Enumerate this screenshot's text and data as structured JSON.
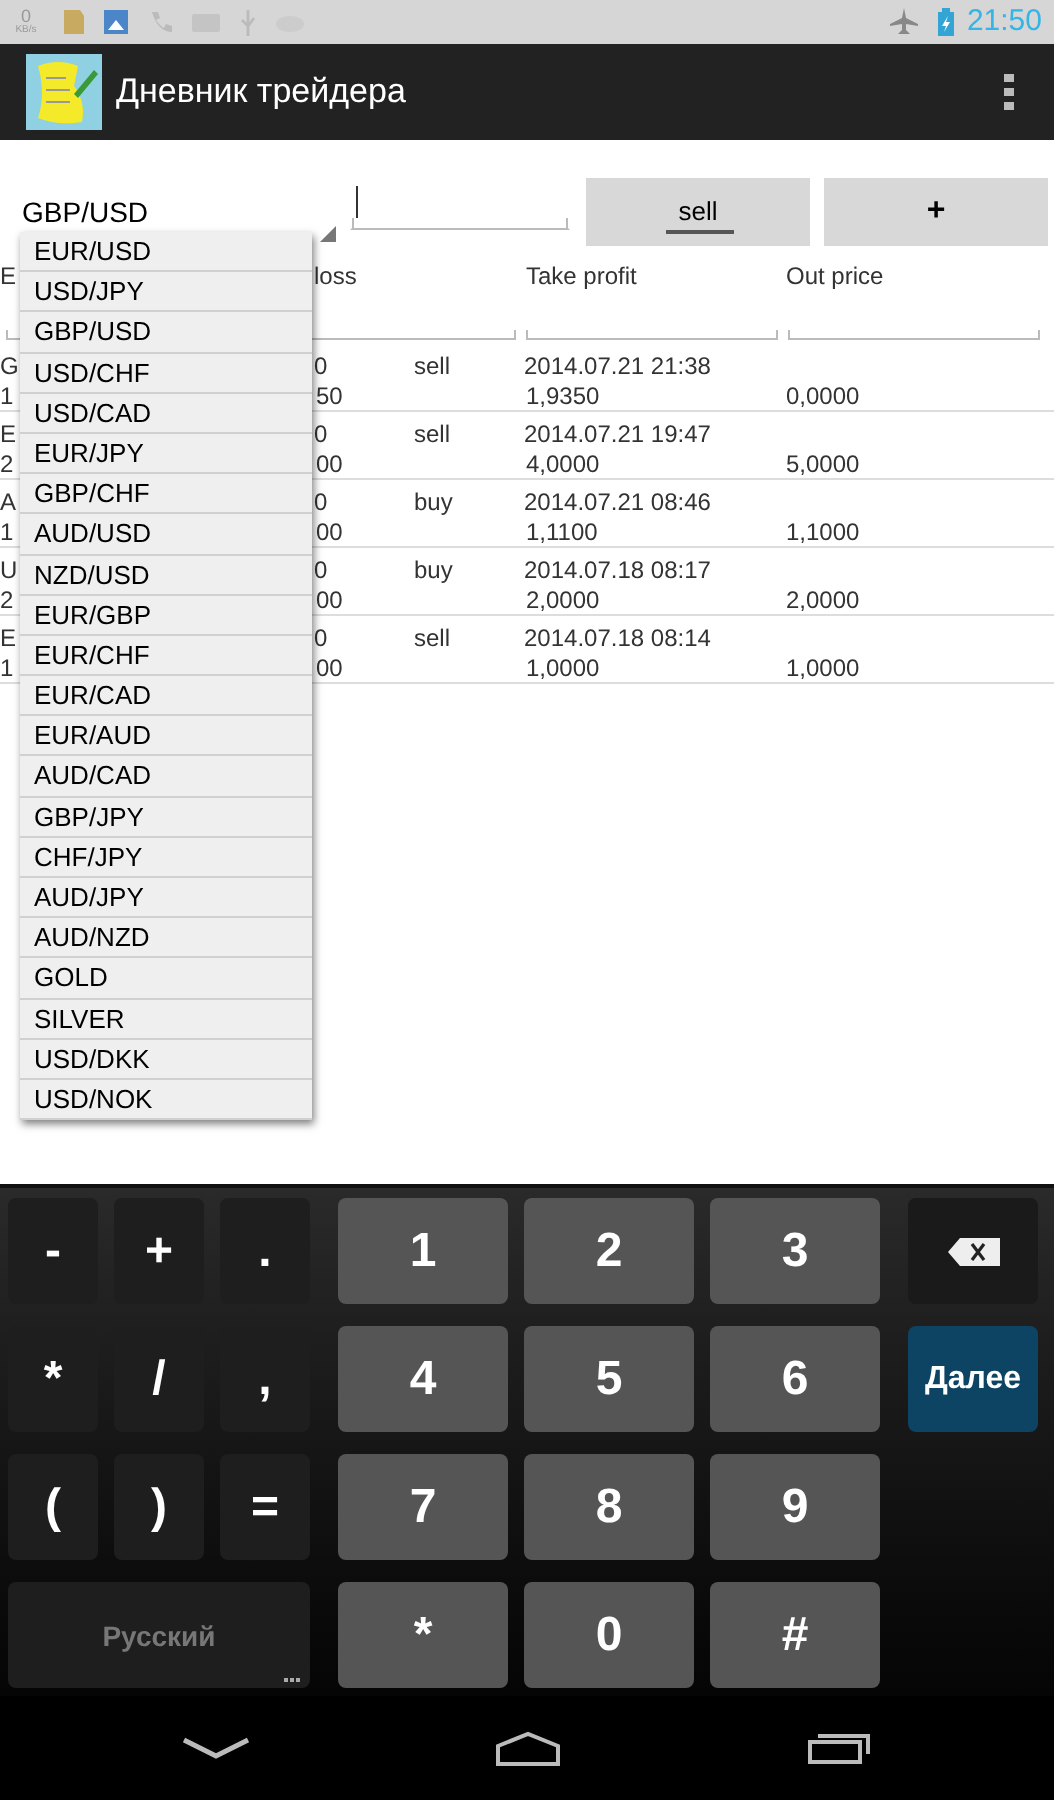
{
  "status_bar": {
    "speed_value": "0",
    "speed_unit": "KB/s",
    "time": "21:50"
  },
  "action_bar": {
    "title": "Дневник трейдера"
  },
  "form": {
    "pair_spinner": {
      "value": "GBP/USD"
    },
    "buttons": [
      {
        "label": "sell",
        "kind": "toggle"
      },
      {
        "label": "+",
        "kind": "plain"
      }
    ]
  },
  "table": {
    "header": [
      "E",
      "loss",
      "Take profit",
      "Out price"
    ],
    "rows": [
      {
        "column_1": "G",
        "column_1b": "1",
        "column_2": "0",
        "column_2b": "50",
        "type": "sell",
        "date": "2014.07.21 21:38",
        "take_profit": "1,9350",
        "out_price": "0,0000"
      },
      {
        "column_1": "E",
        "column_1b": "2",
        "column_2": "0",
        "column_2b": "00",
        "type": "sell",
        "date": "2014.07.21 19:47",
        "take_profit": "4,0000",
        "out_price": "5,0000"
      },
      {
        "column_1": "A",
        "column_1b": "1",
        "column_2": "0",
        "column_2b": "00",
        "type": "buy",
        "date": "2014.07.21 08:46",
        "take_profit": "1,1100",
        "out_price": "1,1000"
      },
      {
        "column_1": "U",
        "column_1b": "2",
        "column_2": "0",
        "column_2b": "00",
        "type": "buy",
        "date": "2014.07.18 08:17",
        "take_profit": "2,0000",
        "out_price": "2,0000"
      },
      {
        "column_1": "E",
        "column_1b": "1",
        "column_2": "0",
        "column_2b": "00",
        "type": "sell",
        "date": "2014.07.18 08:14",
        "take_profit": "1,0000",
        "out_price": "1,0000"
      }
    ]
  },
  "dropdown": {
    "items": [
      "EUR/USD",
      "USD/JPY",
      "GBP/USD",
      "USD/CHF",
      "USD/CAD",
      "EUR/JPY",
      "GBP/CHF",
      "AUD/USD",
      "NZD/USD",
      "EUR/GBP",
      "EUR/CHF",
      "EUR/CAD",
      "EUR/AUD",
      "AUD/CAD",
      "GBP/JPY",
      "CHF/JPY",
      "AUD/JPY",
      "AUD/NZD",
      "GOLD",
      "SILVER",
      "USD/DKK",
      "USD/NOK"
    ]
  },
  "keyboard": {
    "symbol_keys": [
      "-",
      "+",
      ".",
      "*",
      "/",
      ",",
      "(",
      ")",
      "="
    ],
    "language_key": "Русский",
    "digit_keys": [
      "1",
      "2",
      "3",
      "4",
      "5",
      "6",
      "7",
      "8",
      "9",
      "*",
      "0",
      "#"
    ],
    "side_keys": [
      {
        "kind": "backspace"
      },
      {
        "kind": "action",
        "label": "Далее"
      }
    ]
  }
}
